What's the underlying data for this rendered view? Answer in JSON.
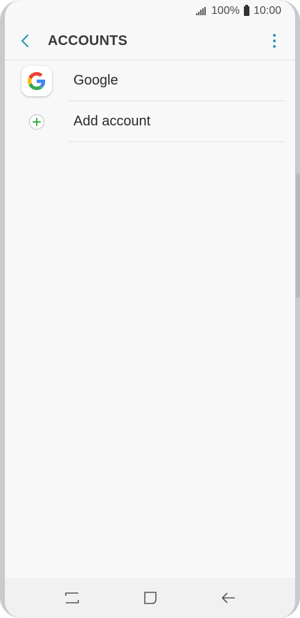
{
  "status_bar": {
    "battery_percent": "100%",
    "time": "10:00",
    "icons": [
      "signal-icon",
      "battery-icon"
    ]
  },
  "header": {
    "title": "ACCOUNTS",
    "back_icon": "chevron-left-icon",
    "menu_icon": "more-vertical-icon"
  },
  "accounts": {
    "items": [
      {
        "label": "Google",
        "icon": "google-icon"
      },
      {
        "label": "Add account",
        "icon": "add-circle-icon"
      }
    ]
  },
  "nav_bar": {
    "icons": [
      "recent-apps-icon",
      "home-icon",
      "back-icon"
    ]
  },
  "colors": {
    "accent": "#2e97b5",
    "add_green": "#3cb043",
    "background": "#f8f8f8"
  }
}
